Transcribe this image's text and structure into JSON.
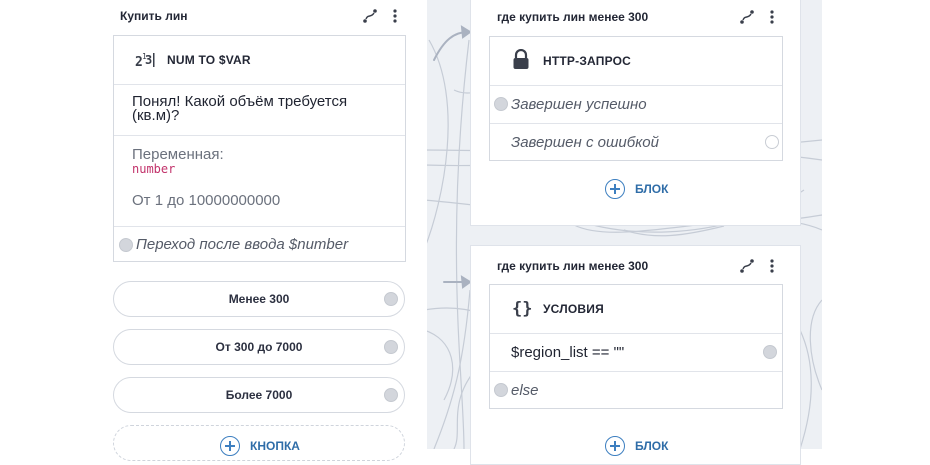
{
  "left_node": {
    "title": "Купить лин",
    "block_type": "NUM TO $VAR",
    "question": "Понял! Какой объём требуется (кв.м)?",
    "variable_label": "Переменная:",
    "variable_name": "number",
    "range": "От 1 до 10000000000",
    "transition": "Переход после ввода $number",
    "buttons": [
      "Менее 300",
      "От 300 до 7000",
      "Более 7000"
    ],
    "add_label": "КНОПКА"
  },
  "right_top_node": {
    "title": "где купить лин менее 300",
    "block_type": "HTTP-ЗАПРОС",
    "outcomes": [
      "Завершен успешно",
      "Завершен с ошибкой"
    ],
    "add_label": "БЛОК"
  },
  "right_bottom_node": {
    "title": "где купить лин менее 300",
    "block_type": "УСЛОВИЯ",
    "conditions": [
      "$region_list == \"\"",
      "else"
    ],
    "add_label": "БЛОК"
  },
  "icons": {
    "edit": "route-edit-icon",
    "menu": "more-vertical-icon",
    "numvar": "number-to-var-icon",
    "lock": "lock-icon",
    "braces": "braces-icon",
    "add": "plus-circle-icon"
  },
  "colors": {
    "accent": "#2f6da8",
    "variable": "#c2336b",
    "canvas": "#edf0f4"
  }
}
